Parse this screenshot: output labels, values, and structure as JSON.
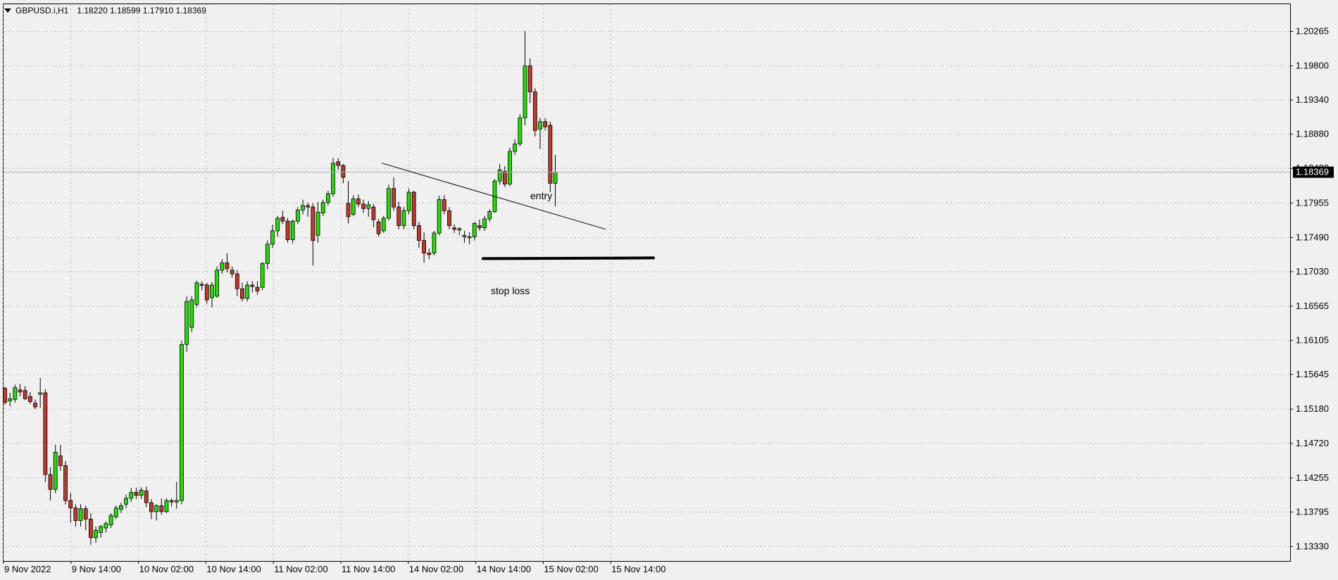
{
  "header": {
    "symbol": "GBPUSD.i,H1",
    "ohlc": "1.18220 1.18599 1.17910 1.18369"
  },
  "colors": {
    "bull": "#22dd00",
    "bear": "#c0392b",
    "outline": "#000000",
    "grid": "#c8c8c8",
    "background": "#f0f0f0"
  },
  "chart_data": {
    "type": "candlestick",
    "title": "GBPUSD.i,H1",
    "grid": true,
    "current_price": "1.18369",
    "y_ticks": [
      "1.20265",
      "1.19800",
      "1.19340",
      "1.18880",
      "1.18420",
      "1.17955",
      "1.17490",
      "1.17030",
      "1.16565",
      "1.16105",
      "1.15645",
      "1.15180",
      "1.14720",
      "1.14255",
      "1.13795",
      "1.13330"
    ],
    "x_ticks": [
      "9 Nov 2022",
      "9 Nov 14:00",
      "10 Nov 02:00",
      "10 Nov 14:00",
      "11 Nov 02:00",
      "11 Nov 14:00",
      "14 Nov 02:00",
      "14 Nov 14:00",
      "15 Nov 02:00",
      "15 Nov 14:00"
    ],
    "ylim": [
      1.1325,
      1.2041
    ],
    "candles": [
      [
        1.1546,
        1.1548,
        1.1524,
        1.1527
      ],
      [
        1.1529,
        1.154,
        1.1522,
        1.1532
      ],
      [
        1.1531,
        1.1551,
        1.1527,
        1.1547
      ],
      [
        1.1544,
        1.1552,
        1.1535,
        1.1541
      ],
      [
        1.1543,
        1.1549,
        1.153,
        1.1532
      ],
      [
        1.1535,
        1.1541,
        1.1525,
        1.1528
      ],
      [
        1.1526,
        1.1531,
        1.1518,
        1.1521
      ],
      [
        1.1538,
        1.156,
        1.152,
        1.154
      ],
      [
        1.154,
        1.1545,
        1.142,
        1.143
      ],
      [
        1.143,
        1.144,
        1.1395,
        1.141
      ],
      [
        1.141,
        1.147,
        1.1405,
        1.146
      ],
      [
        1.1455,
        1.147,
        1.1435,
        1.1442
      ],
      [
        1.1442,
        1.1448,
        1.139,
        1.1395
      ],
      [
        1.1395,
        1.1405,
        1.1365,
        1.1385
      ],
      [
        1.1385,
        1.139,
        1.136,
        1.1368
      ],
      [
        1.1368,
        1.139,
        1.136,
        1.1384
      ],
      [
        1.1384,
        1.1388,
        1.1355,
        1.137
      ],
      [
        1.137,
        1.1378,
        1.1335,
        1.1345
      ],
      [
        1.1345,
        1.136,
        1.1338,
        1.1355
      ],
      [
        1.1352,
        1.1362,
        1.1345,
        1.136
      ],
      [
        1.1358,
        1.1367,
        1.1352,
        1.1364
      ],
      [
        1.1362,
        1.1378,
        1.1358,
        1.1375
      ],
      [
        1.1373,
        1.1388,
        1.137,
        1.1385
      ],
      [
        1.1383,
        1.1392,
        1.1378,
        1.1388
      ],
      [
        1.139,
        1.1403,
        1.1385,
        1.1398
      ],
      [
        1.1398,
        1.1412,
        1.1393,
        1.1406
      ],
      [
        1.1406,
        1.1412,
        1.1397,
        1.1402
      ],
      [
        1.1402,
        1.1413,
        1.1397,
        1.1409
      ],
      [
        1.1408,
        1.1414,
        1.1386,
        1.1392
      ],
      [
        1.1392,
        1.1397,
        1.137,
        1.138
      ],
      [
        1.138,
        1.139,
        1.1368,
        1.1388
      ],
      [
        1.1388,
        1.1398,
        1.1376,
        1.138
      ],
      [
        1.138,
        1.1398,
        1.1378,
        1.1395
      ],
      [
        1.1395,
        1.1398,
        1.1387,
        1.1393
      ],
      [
        1.1393,
        1.142,
        1.1384,
        1.1395
      ],
      [
        1.1395,
        1.161,
        1.139,
        1.1605
      ],
      [
        1.1605,
        1.167,
        1.1595,
        1.1663
      ],
      [
        1.1628,
        1.167,
        1.1622,
        1.1665
      ],
      [
        1.1659,
        1.1691,
        1.1655,
        1.1688
      ],
      [
        1.1686,
        1.169,
        1.1678,
        1.1685
      ],
      [
        1.1685,
        1.1688,
        1.166,
        1.1665
      ],
      [
        1.1668,
        1.1689,
        1.1655,
        1.1685
      ],
      [
        1.167,
        1.171,
        1.1668,
        1.1705
      ],
      [
        1.1705,
        1.172,
        1.17,
        1.1715
      ],
      [
        1.1715,
        1.1728,
        1.1702,
        1.1707
      ],
      [
        1.1705,
        1.171,
        1.1695,
        1.17
      ],
      [
        1.17,
        1.1705,
        1.167,
        1.168
      ],
      [
        1.168,
        1.1688,
        1.1663,
        1.1667
      ],
      [
        1.1667,
        1.169,
        1.1663,
        1.1685
      ],
      [
        1.1685,
        1.169,
        1.1675,
        1.1683
      ],
      [
        1.1682,
        1.169,
        1.1672,
        1.1677
      ],
      [
        1.1682,
        1.1716,
        1.1678,
        1.1714
      ],
      [
        1.1714,
        1.1745,
        1.1706,
        1.174
      ],
      [
        1.174,
        1.1766,
        1.1735,
        1.1758
      ],
      [
        1.1758,
        1.1778,
        1.175,
        1.1775
      ],
      [
        1.1776,
        1.1785,
        1.1767,
        1.1771
      ],
      [
        1.1771,
        1.1775,
        1.1742,
        1.1746
      ],
      [
        1.1746,
        1.1773,
        1.1741,
        1.1771
      ],
      [
        1.1771,
        1.179,
        1.1767,
        1.1786
      ],
      [
        1.1786,
        1.18,
        1.178,
        1.1792
      ],
      [
        1.1792,
        1.1796,
        1.1777,
        1.179
      ],
      [
        1.179,
        1.1795,
        1.1711,
        1.1745
      ],
      [
        1.1752,
        1.1797,
        1.1742,
        1.1783
      ],
      [
        1.1782,
        1.18,
        1.1778,
        1.1796
      ],
      [
        1.1796,
        1.1812,
        1.1792,
        1.1808
      ],
      [
        1.1808,
        1.1856,
        1.1804,
        1.1849
      ],
      [
        1.1851,
        1.1856,
        1.184,
        1.1846
      ],
      [
        1.1846,
        1.1848,
        1.1822,
        1.183
      ],
      [
        1.1795,
        1.1825,
        1.1768,
        1.1777
      ],
      [
        1.178,
        1.1806,
        1.1778,
        1.1801
      ],
      [
        1.1801,
        1.1807,
        1.179,
        1.1794
      ],
      [
        1.1794,
        1.18,
        1.1782,
        1.1788
      ],
      [
        1.1788,
        1.1798,
        1.1777,
        1.1793
      ],
      [
        1.179,
        1.1794,
        1.1763,
        1.1773
      ],
      [
        1.177,
        1.1774,
        1.175,
        1.1754
      ],
      [
        1.1758,
        1.1778,
        1.1755,
        1.1775
      ],
      [
        1.1775,
        1.182,
        1.1772,
        1.1815
      ],
      [
        1.1815,
        1.183,
        1.1785,
        1.179
      ],
      [
        1.179,
        1.1797,
        1.176,
        1.1765
      ],
      [
        1.1765,
        1.179,
        1.176,
        1.1785
      ],
      [
        1.1785,
        1.1815,
        1.178,
        1.181
      ],
      [
        1.181,
        1.1812,
        1.176,
        1.1765
      ],
      [
        1.1765,
        1.177,
        1.1735,
        1.1745
      ],
      [
        1.1745,
        1.1756,
        1.1715,
        1.1728
      ],
      [
        1.1728,
        1.1734,
        1.172,
        1.1726
      ],
      [
        1.1728,
        1.1758,
        1.1725,
        1.1755
      ],
      [
        1.1755,
        1.1805,
        1.1752,
        1.18
      ],
      [
        1.18,
        1.1806,
        1.178,
        1.1785
      ],
      [
        1.1785,
        1.179,
        1.176,
        1.1765
      ],
      [
        1.1762,
        1.1767,
        1.1755,
        1.176
      ],
      [
        1.1759,
        1.1763,
        1.1752,
        1.1761
      ],
      [
        1.175,
        1.1758,
        1.1742,
        1.1752
      ],
      [
        1.175,
        1.1756,
        1.174,
        1.175
      ],
      [
        1.175,
        1.177,
        1.1745,
        1.1768
      ],
      [
        1.1765,
        1.1773,
        1.1758,
        1.1762
      ],
      [
        1.1762,
        1.1778,
        1.1758,
        1.1774
      ],
      [
        1.1774,
        1.1787,
        1.177,
        1.1784
      ],
      [
        1.1784,
        1.1828,
        1.1782,
        1.1825
      ],
      [
        1.1825,
        1.1848,
        1.182,
        1.184
      ],
      [
        1.1838,
        1.1845,
        1.1817,
        1.1821
      ],
      [
        1.1821,
        1.187,
        1.1818,
        1.1865
      ],
      [
        1.1865,
        1.1881,
        1.186,
        1.1875
      ],
      [
        1.1875,
        1.1915,
        1.1872,
        1.191
      ],
      [
        1.191,
        1.2027,
        1.19,
        1.198
      ],
      [
        1.198,
        1.199,
        1.193,
        1.1945
      ],
      [
        1.1945,
        1.195,
        1.1885,
        1.1893
      ],
      [
        1.1895,
        1.191,
        1.1868,
        1.1905
      ],
      [
        1.1905,
        1.191,
        1.1893,
        1.1898
      ],
      [
        1.19,
        1.1905,
        1.181,
        1.1822
      ],
      [
        1.1822,
        1.186,
        1.1791,
        1.1837
      ]
    ],
    "annotations": {
      "entry": "entry",
      "stop": "stop loss",
      "trendline": [
        [
          1.1852,
          1.1762
        ]
      ],
      "stop_level": 1.17215
    }
  }
}
